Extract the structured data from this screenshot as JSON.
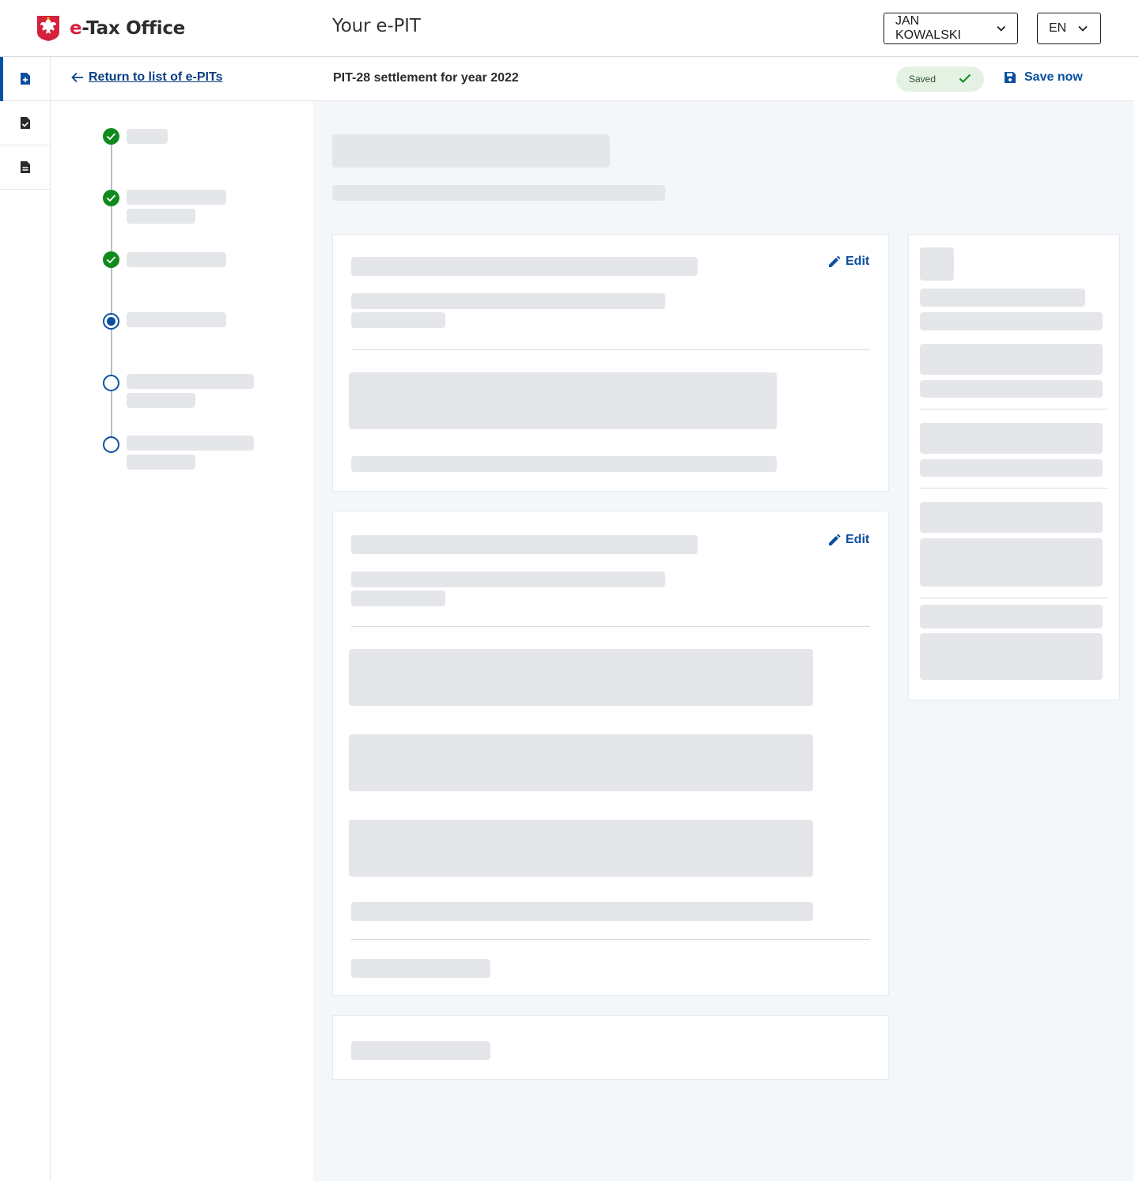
{
  "header": {
    "brand_prefix": "e",
    "brand_suffix": "-Tax Office",
    "page_heading": "Your e-PIT",
    "user_select": "JAN KOWALSKI",
    "language_select": "EN"
  },
  "subheader": {
    "back_link": "Return to list of e-PITs",
    "document_title": "PIT-28 settlement for year 2022",
    "saved_status": "Saved",
    "save_now": "Save now"
  },
  "sections": [
    {
      "edit_label": "Edit"
    },
    {
      "edit_label": "Edit"
    }
  ],
  "stepper": {
    "steps": [
      {
        "state": "done"
      },
      {
        "state": "done"
      },
      {
        "state": "done"
      },
      {
        "state": "current"
      },
      {
        "state": "todo"
      },
      {
        "state": "todo"
      }
    ]
  },
  "rail": {
    "items": [
      {
        "icon": "document-add-icon",
        "active": true
      },
      {
        "icon": "document-check-icon",
        "active": false
      },
      {
        "icon": "document-text-icon",
        "active": false
      }
    ]
  },
  "colors": {
    "brand_red": "#d4213d",
    "primary_blue": "#0b4fa0",
    "success_green": "#108a1c",
    "saved_badge_bg": "#e3f2e3",
    "skeleton": "#e4e6ea",
    "main_bg": "#f4f7fa"
  }
}
